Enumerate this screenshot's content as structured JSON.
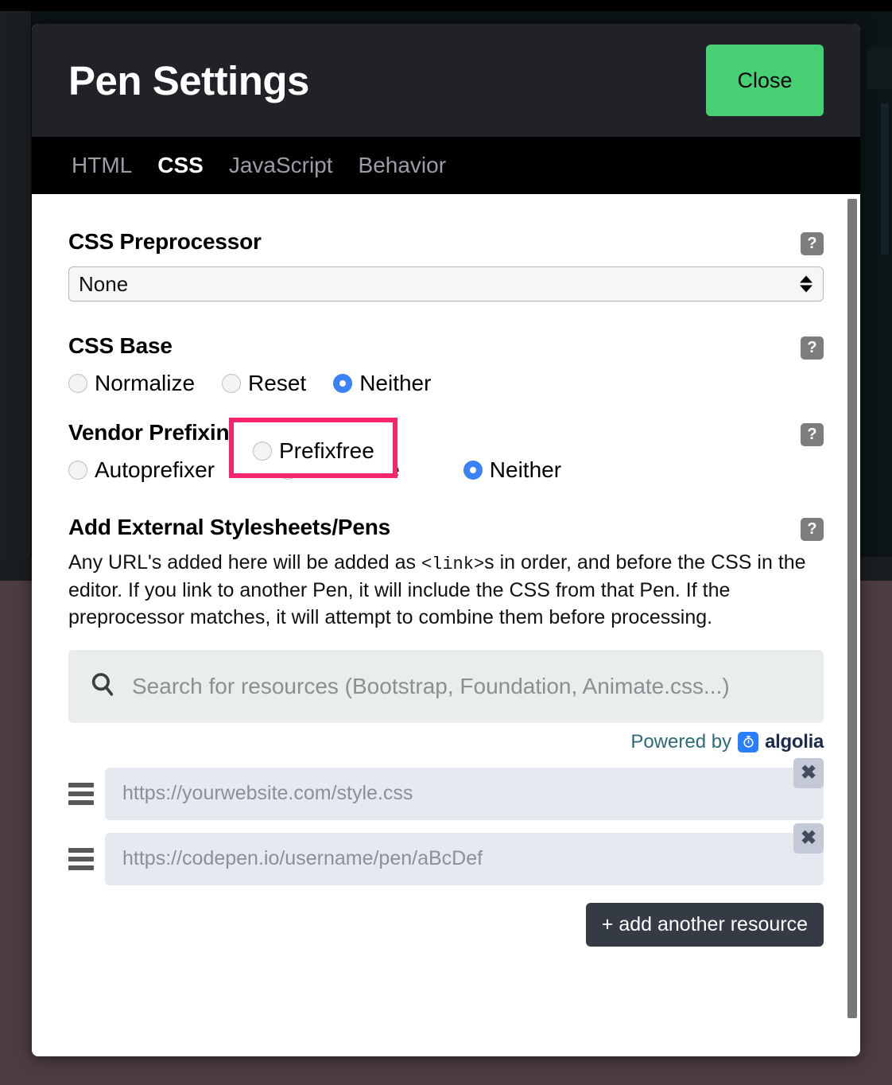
{
  "modal": {
    "title": "Pen Settings",
    "close_label": "Close",
    "tabs": [
      {
        "label": "HTML",
        "active": false
      },
      {
        "label": "CSS",
        "active": true
      },
      {
        "label": "JavaScript",
        "active": false
      },
      {
        "label": "Behavior",
        "active": false
      }
    ]
  },
  "preprocessor": {
    "title": "CSS Preprocessor",
    "help": "?",
    "value": "None",
    "options": [
      "None"
    ]
  },
  "css_base": {
    "title": "CSS Base",
    "help": "?",
    "options": [
      {
        "label": "Normalize",
        "checked": false
      },
      {
        "label": "Reset",
        "checked": false
      },
      {
        "label": "Neither",
        "checked": true
      }
    ]
  },
  "vendor_prefixing": {
    "title": "Vendor Prefixing",
    "help": "?",
    "options": [
      {
        "label": "Autoprefixer",
        "checked": false
      },
      {
        "label": "Prefixfree",
        "checked": false
      },
      {
        "label": "Neither",
        "checked": true
      }
    ],
    "highlight_color": "#f4266e",
    "highlighted_option": "Prefixfree"
  },
  "external": {
    "title": "Add External Stylesheets/Pens",
    "help": "?",
    "desc_part1": "Any URL's added here will be added as ",
    "desc_code": "<link>",
    "desc_part2": "s in order, and before the CSS in the editor. If you link to another Pen, it will include the CSS from that Pen. If the preprocessor matches, it will attempt to combine them before processing.",
    "search_placeholder": "Search for resources (Bootstrap, Foundation, Animate.css...)",
    "search_value": "",
    "powered_by": "Powered by",
    "algolia": "algolia",
    "resources": [
      {
        "placeholder": "https://yourwebsite.com/style.css",
        "value": "",
        "remove_label": "✖"
      },
      {
        "placeholder": "https://codepen.io/username/pen/aBcDef",
        "value": "",
        "remove_label": "✖"
      }
    ],
    "add_label": "+ add another resource"
  },
  "colors": {
    "accent_green": "#47cf73",
    "header_bg": "#212227",
    "highlight_pink": "#f4266e",
    "radio_blue": "#3b82f6",
    "algolia_blue": "#2b7fff"
  }
}
